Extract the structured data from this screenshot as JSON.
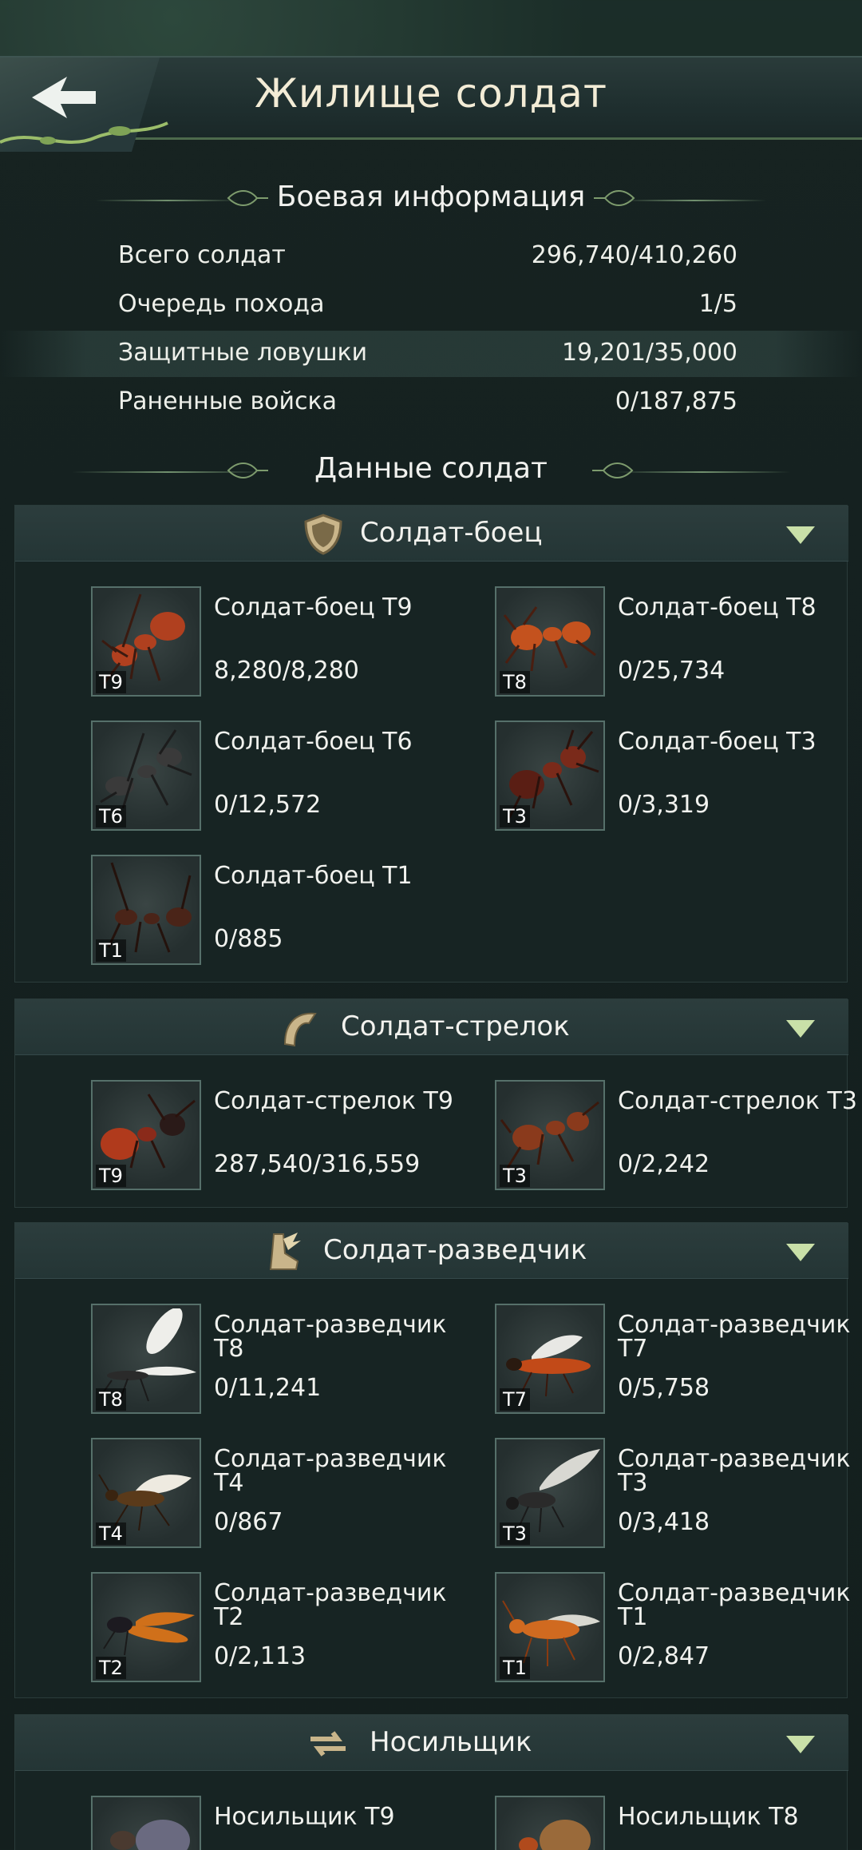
{
  "header": {
    "title": "Жилище солдат"
  },
  "battle_info": {
    "heading": "Боевая информация",
    "rows": [
      {
        "label": "Всего солдат",
        "value": "296,740/410,260"
      },
      {
        "label": "Очередь похода",
        "value": "1/5"
      },
      {
        "label": "Защитные ловушки",
        "value": "19,201/35,000"
      },
      {
        "label": "Раненные войска",
        "value": "0/187,875"
      }
    ]
  },
  "soldier_data": {
    "heading": "Данные солдат"
  },
  "groups": [
    {
      "title": "Солдат-боец",
      "icon": "shield-icon",
      "units": [
        {
          "name": "Солдат-боец T9",
          "count": "8,280/8,280",
          "tier": "T9",
          "color": "#b0401f"
        },
        {
          "name": "Солдат-боец T8",
          "count": "0/25,734",
          "tier": "T8",
          "color": "#c4521e"
        },
        {
          "name": "Солдат-боец T6",
          "count": "0/12,572",
          "tier": "T6",
          "color": "#3a3a3a"
        },
        {
          "name": "Солдат-боец T3",
          "count": "0/3,319",
          "tier": "T3",
          "color": "#7a2a1a"
        },
        {
          "name": "Солдат-боец T1",
          "count": "0/885",
          "tier": "T1",
          "color": "#4a2418"
        }
      ]
    },
    {
      "title": "Солдат-стрелок",
      "icon": "bow-icon",
      "units": [
        {
          "name": "Солдат-стрелок T9",
          "count": "287,540/316,559",
          "tier": "T9",
          "color": "#b03a1c"
        },
        {
          "name": "Солдат-стрелок T3",
          "count": "0/2,242",
          "tier": "T3",
          "color": "#8a3a1c"
        }
      ]
    },
    {
      "title": "Солдат-разведчик",
      "icon": "wing-boot-icon",
      "units": [
        {
          "name": "Солдат-разведчик T8",
          "count": "0/11,241",
          "tier": "T8",
          "color": "#2a2a2a"
        },
        {
          "name": "Солдат-разведчик T7",
          "count": "0/5,758",
          "tier": "T7",
          "color": "#c24a18"
        },
        {
          "name": "Солдат-разведчик T4",
          "count": "0/867",
          "tier": "T4",
          "color": "#5a3a1a"
        },
        {
          "name": "Солдат-разведчик T3",
          "count": "0/3,418",
          "tier": "T3",
          "color": "#2a2a2a"
        },
        {
          "name": "Солдат-разведчик T2",
          "count": "0/2,113",
          "tier": "T2",
          "color": "#d0701a"
        },
        {
          "name": "Солдат-разведчик T1",
          "count": "0/2,847",
          "tier": "T1",
          "color": "#d06a20"
        }
      ]
    },
    {
      "title": "Носильщик",
      "icon": "arrows-icon",
      "units": [
        {
          "name": "Носильщик T9",
          "count": "",
          "tier": "T9",
          "color": "#6a6a80"
        },
        {
          "name": "Носильщик T8",
          "count": "",
          "tier": "T8",
          "color": "#9a6a3a"
        }
      ]
    }
  ]
}
